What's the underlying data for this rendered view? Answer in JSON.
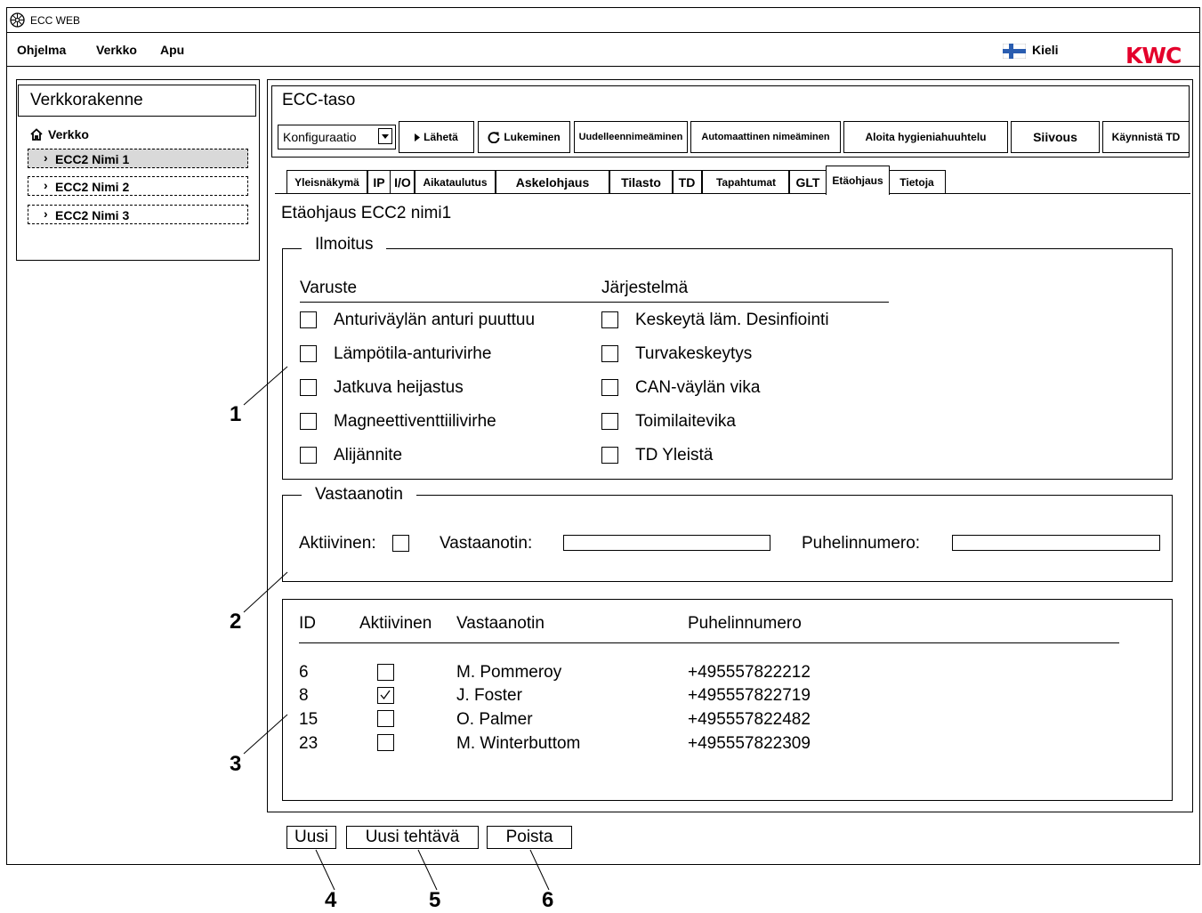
{
  "window": {
    "title": "ECC WEB"
  },
  "menu": {
    "items": [
      "Ohjelma",
      "Verkko",
      "Apu"
    ],
    "language_label": "Kieli",
    "logo": "KWC"
  },
  "colors": {
    "brand_red": "#e4002b",
    "finland_blue": "#2a5db0",
    "selected_bg": "#d9d9d9"
  },
  "left_panel": {
    "title": "Verkkorakenne",
    "root_label": "Verkko",
    "nodes": [
      "ECC2 Nimi 1",
      "ECC2 Nimi 2",
      "ECC2 Nimi 3"
    ]
  },
  "right_panel": {
    "title": "ECC-taso",
    "mode_select": "Konfiguraatio",
    "toolbar": [
      "Lähetä",
      "Lukeminen",
      "Uudelleennimeäminen",
      "Automaattinen nimeäminen",
      "Aloita hygieniahuuhtelu",
      "Siivous",
      "Käynnistä TD"
    ],
    "tabs": [
      "Yleisnäkymä",
      "IP",
      "I/O",
      "Aikataulutus",
      "Askelohjaus",
      "Tilasto",
      "TD",
      "Tapahtumat",
      "GLT",
      "Etäohjaus",
      "Tietoja"
    ],
    "active_tab": "Etäohjaus"
  },
  "content": {
    "heading": "Etäohjaus ECC2 nimi1",
    "notification": {
      "legend": "Ilmoitus",
      "equipment_header": "Varuste",
      "system_header": "Järjestelmä",
      "equipment": [
        "Anturiväylän anturi puuttuu",
        "Lämpötila-anturivirhe",
        "Jatkuva heijastus",
        "Magneettiventtiilivirhe",
        "Alijännite"
      ],
      "system": [
        "Keskeytä läm. Desinfiointi",
        "Turvakeskeytys",
        "CAN-väylän vika",
        "Toimilaitevika",
        "TD Yleistä"
      ]
    },
    "receiver": {
      "legend": "Vastaanotin",
      "active_label": "Aktiivinen:",
      "receiver_label": "Vastaanotin:",
      "phone_label": "Puhelinnumero:",
      "receiver_value": "",
      "phone_value": ""
    },
    "table": {
      "headers": [
        "ID",
        "Aktiivinen",
        "Vastaanotin",
        "Puhelinnumero"
      ],
      "rows": [
        {
          "id": "6",
          "active": false,
          "name": "M. Pommeroy",
          "phone": "+495557822212"
        },
        {
          "id": "8",
          "active": true,
          "name": "J. Foster",
          "phone": "+495557822719"
        },
        {
          "id": "15",
          "active": false,
          "name": "O. Palmer",
          "phone": "+495557822482"
        },
        {
          "id": "23",
          "active": false,
          "name": "M. Winterbuttom",
          "phone": "+495557822309"
        }
      ]
    }
  },
  "buttons": {
    "new": "Uusi",
    "new_task": "Uusi tehtävä",
    "delete": "Poista"
  },
  "callouts": [
    "1",
    "2",
    "3",
    "4",
    "5",
    "6"
  ]
}
